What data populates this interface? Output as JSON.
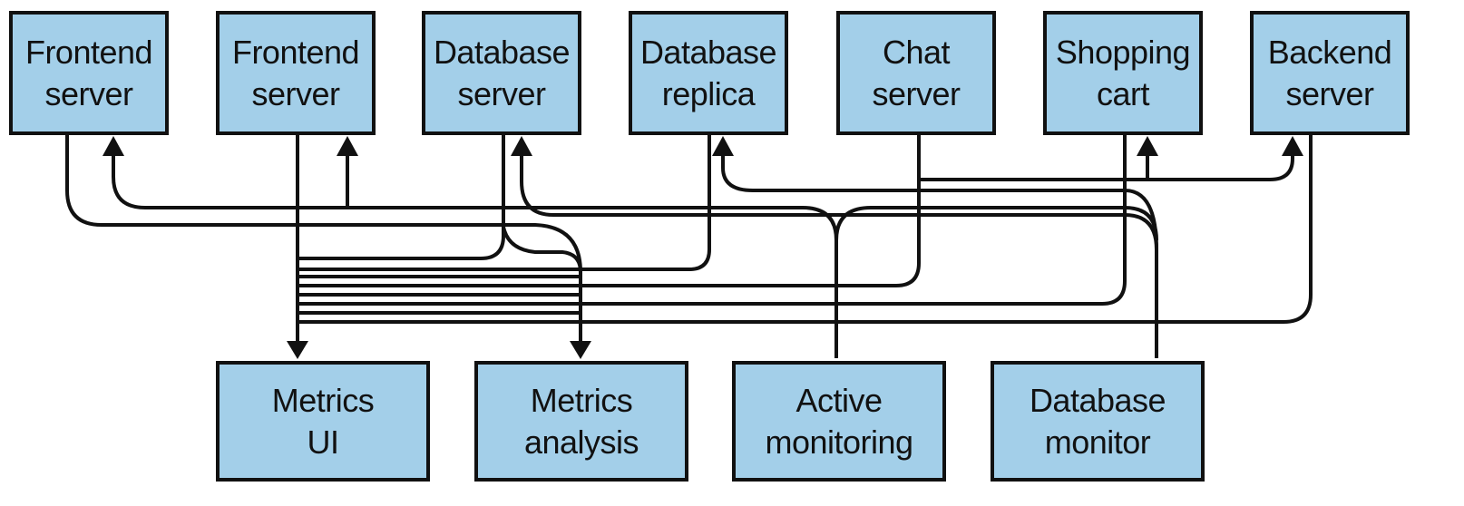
{
  "top_nodes": [
    {
      "label": "Frontend\nserver"
    },
    {
      "label": "Frontend\nserver"
    },
    {
      "label": "Database\nserver"
    },
    {
      "label": "Database\nreplica"
    },
    {
      "label": "Chat\nserver"
    },
    {
      "label": "Shopping\ncart"
    },
    {
      "label": "Backend\nserver"
    }
  ],
  "bottom_nodes": [
    {
      "label": "Metrics\nUI"
    },
    {
      "label": "Metrics\nanalysis"
    },
    {
      "label": "Active\nmonitoring"
    },
    {
      "label": "Database\nmonitor"
    }
  ],
  "colors": {
    "box_fill": "#a3cfe9",
    "stroke": "#111111"
  }
}
